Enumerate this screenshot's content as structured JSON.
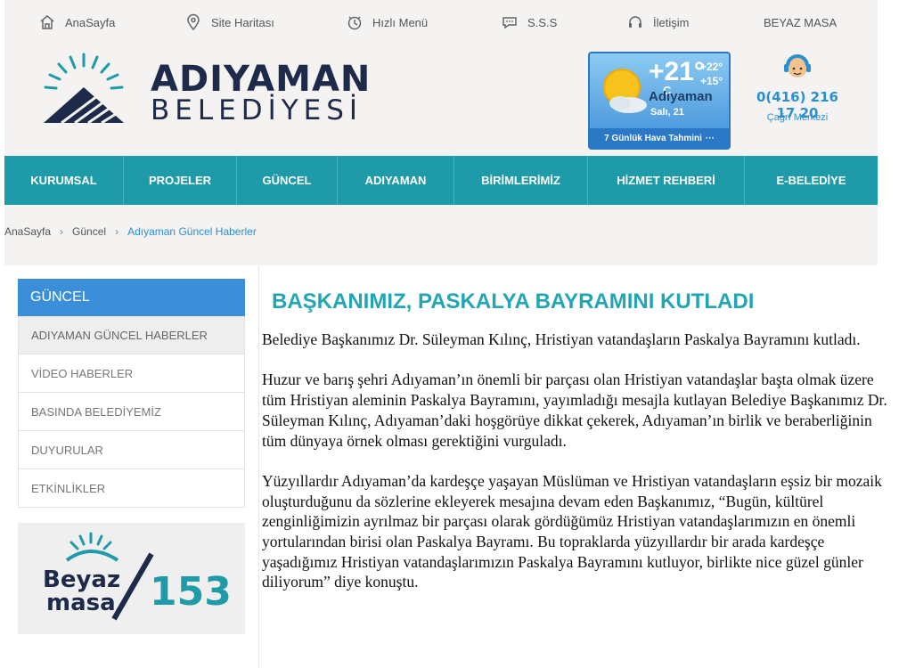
{
  "topbar": {
    "items": [
      {
        "label": "AnaSayfa",
        "icon": "home-icon"
      },
      {
        "label": "Site Haritası",
        "icon": "map-pin-icon"
      },
      {
        "label": "Hızlı Menü",
        "icon": "clock-icon"
      },
      {
        "label": "S.S.S",
        "icon": "chat-bubble-icon"
      },
      {
        "label": "İletişim",
        "icon": "headset-icon"
      },
      {
        "label": "BEYAZ MASA",
        "icon": ""
      }
    ]
  },
  "logo": {
    "title": "ADIYAMAN",
    "subtitle": "BELEDİYESİ"
  },
  "weather": {
    "temp": "+21°",
    "unit": "C",
    "max": "+22°",
    "min": "+15°",
    "city": "Adıyaman",
    "date": "Salı, 21",
    "footer": "7 Günlük Hava Tahmini",
    "footer_more": "···"
  },
  "call_center": {
    "phone": "0(416) 216 17 20",
    "label": "Çağrı Merkezi"
  },
  "nav": [
    "KURUMSAL",
    "PROJELER",
    "GÜNCEL",
    "ADIYAMAN",
    "BİRİMLERİMİZ",
    "HİZMET REHBERİ",
    "E-BELEDİYE"
  ],
  "breadcrumb": {
    "home": "AnaSayfa",
    "section": "Güncel",
    "current": "Adıyaman Güncel Haberler",
    "sep": "›"
  },
  "sidebar": {
    "title": "GÜNCEL",
    "items": [
      "ADIYAMAN GÜNCEL HABERLER",
      "VİDEO HABERLER",
      "BASINDA BELEDİYEMİZ",
      "DUYURULAR",
      "ETKİNLİKLER"
    ]
  },
  "banner": {
    "line1": "Beyaz",
    "line2": "masa",
    "number": "153"
  },
  "article": {
    "title": "BAŞKANIMIZ, PASKALYA BAYRAMINI KUTLADI",
    "paragraphs": [
      "Belediye Başkanımız Dr. Süleyman Kılınç, Hristiyan vatandaşların Paskalya Bayramını kutladı.",
      "Huzur ve barış şehri Adıyaman’ın önemli bir parçası olan Hristiyan vatandaşlar başta olmak üzere tüm Hristiyan aleminin Paskalya Bayramını, yayımladığı mesajla kutlayan Belediye Başkanımız Dr. Süleyman Kılınç, Adıyaman’daki hoşgörüye dikkat çekerek, Adıyaman’ın birlik ve beraberliğinin tüm dünyaya örnek olması gerektiğini vurguladı.",
      "Yüzyıllardır Adıyaman’da kardeşçe yaşayan Müslüman ve Hristiyan vatandaşların eşsiz bir mozaik oluşturduğunu da sözlerine ekleyerek mesajına devam eden Başkanımız, “Bugün, kültürel zenginliğimizin ayrılmaz bir parçası olarak gördüğümüz Hristiyan vatandaşlarımızın en önemli yortularından birisi olan Paskalya Bayramı. Bu topraklarda yüzyıllardır bir arada kardeşçe yaşadığımız Hristiyan vatandaşlarımızın Paskalya Bayramını kutluyor, birlikte nice güzel günler diliyorum” diye konuştu."
    ]
  },
  "colors": {
    "nav": "#1e9aa8",
    "accent_blue": "#3b8fd8",
    "title": "#22a6b3",
    "logo": "#1d2a4a"
  }
}
